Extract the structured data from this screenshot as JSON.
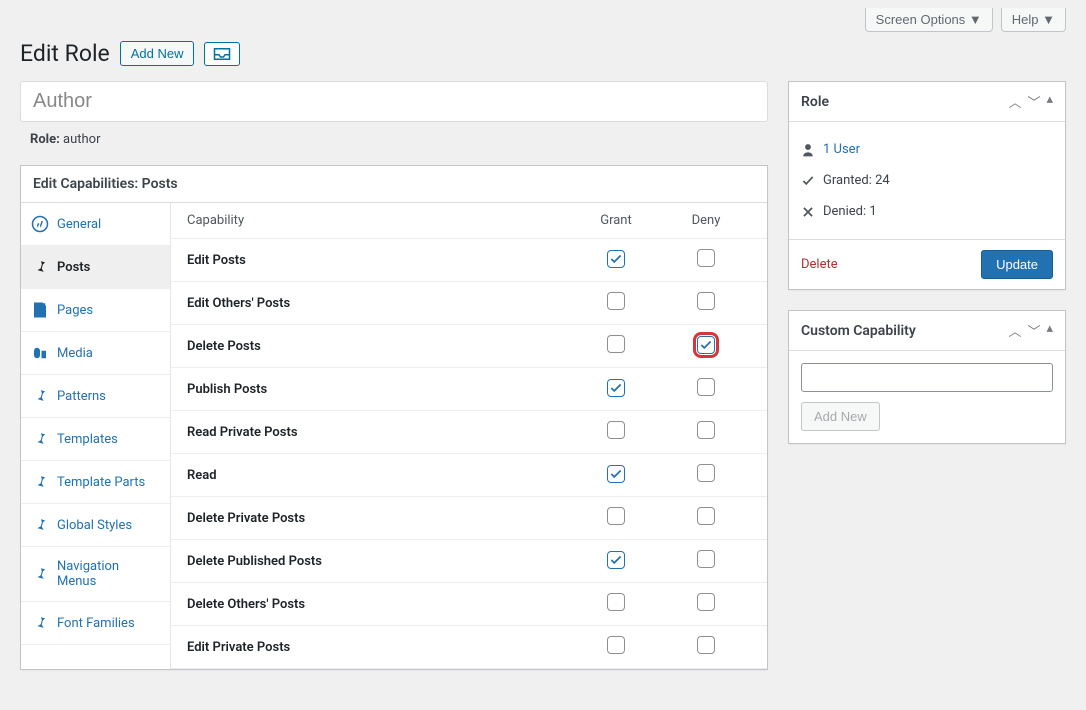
{
  "topbar": {
    "screen_options": "Screen Options",
    "help": "Help"
  },
  "header": {
    "title": "Edit Role",
    "add_new": "Add New"
  },
  "title_value": "Author",
  "role_label": "Role:",
  "role_value": "author",
  "caps_panel_title": "Edit Capabilities: Posts",
  "nav": [
    {
      "label": "General",
      "icon": "wordpress",
      "active": false
    },
    {
      "label": "Posts",
      "icon": "pin",
      "active": true
    },
    {
      "label": "Pages",
      "icon": "page",
      "active": false
    },
    {
      "label": "Media",
      "icon": "media",
      "active": false
    },
    {
      "label": "Patterns",
      "icon": "pin",
      "active": false
    },
    {
      "label": "Templates",
      "icon": "pin",
      "active": false
    },
    {
      "label": "Template Parts",
      "icon": "pin",
      "active": false
    },
    {
      "label": "Global Styles",
      "icon": "pin",
      "active": false
    },
    {
      "label": "Navigation Menus",
      "icon": "pin",
      "active": false
    },
    {
      "label": "Font Families",
      "icon": "pin",
      "active": false
    }
  ],
  "columns": {
    "capability": "Capability",
    "grant": "Grant",
    "deny": "Deny"
  },
  "rows": [
    {
      "cap": "Edit Posts",
      "grant": true,
      "deny": false,
      "hl": false
    },
    {
      "cap": "Edit Others' Posts",
      "grant": false,
      "deny": false,
      "hl": false
    },
    {
      "cap": "Delete Posts",
      "grant": false,
      "deny": true,
      "hl": true
    },
    {
      "cap": "Publish Posts",
      "grant": true,
      "deny": false,
      "hl": false
    },
    {
      "cap": "Read Private Posts",
      "grant": false,
      "deny": false,
      "hl": false
    },
    {
      "cap": "Read",
      "grant": true,
      "deny": false,
      "hl": false
    },
    {
      "cap": "Delete Private Posts",
      "grant": false,
      "deny": false,
      "hl": false
    },
    {
      "cap": "Delete Published Posts",
      "grant": true,
      "deny": false,
      "hl": false
    },
    {
      "cap": "Delete Others' Posts",
      "grant": false,
      "deny": false,
      "hl": false
    },
    {
      "cap": "Edit Private Posts",
      "grant": false,
      "deny": false,
      "hl": false
    }
  ],
  "role_box": {
    "title": "Role",
    "users_link": "1 User",
    "granted": "Granted: 24",
    "denied": "Denied: 1",
    "delete": "Delete",
    "update": "Update"
  },
  "custom_box": {
    "title": "Custom Capability",
    "add_new": "Add New"
  }
}
